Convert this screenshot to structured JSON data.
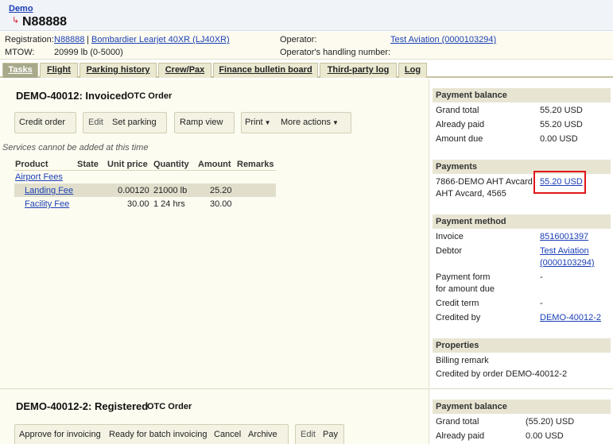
{
  "breadcrumb": {
    "link": "Demo",
    "title": "N88888"
  },
  "aircraft": {
    "registration_label": "Registration:",
    "registration": "N88888",
    "separator": "|",
    "type": "Bombardier Learjet 40XR (LJ40XR)",
    "mtow_label": "MTOW:",
    "mtow": "20999 lb (0-5000)",
    "operator_label": "Operator:",
    "operator": "Test Aviation (0000103294)",
    "handling_label": "Operator's handling number:"
  },
  "tabs": [
    "Tasks",
    "Flight",
    "Parking history",
    "Crew/Pax",
    "Finance bulletin board",
    "Third-party log",
    "Log"
  ],
  "order1": {
    "id": "DEMO-40012: Invoiced",
    "type": "OTC Order",
    "buttons": {
      "credit": "Credit order",
      "edit": "Edit",
      "set_parking": "Set parking",
      "ramp": "Ramp view",
      "print": "Print",
      "more": "More actions"
    },
    "notice": "Services cannot be added at this time",
    "columns": [
      "Product",
      "State",
      "Unit price",
      "Quantity",
      "Amount",
      "Remarks"
    ],
    "group": "Airport Fees",
    "rows": [
      {
        "product": "Landing Fee",
        "state": "",
        "unit_price": "0.00120",
        "quantity": "21000 lb",
        "amount": "25.20",
        "remarks": ""
      },
      {
        "product": "Facility Fee",
        "state": "",
        "unit_price": "30.00",
        "quantity": "1 24 hrs",
        "amount": "30.00",
        "remarks": ""
      }
    ]
  },
  "payment_balance": {
    "header": "Payment balance",
    "grand_total_label": "Grand total",
    "grand_total": "55.20 USD",
    "paid_label": "Already paid",
    "paid": "55.20 USD",
    "due_label": "Amount due",
    "due": "0.00 USD"
  },
  "payments": {
    "header": "Payments",
    "line1": "7866-DEMO AHT Avcard",
    "line2": "AHT Avcard, 4565",
    "amount": "55.20 USD"
  },
  "payment_method": {
    "header": "Payment method",
    "invoice_label": "Invoice",
    "invoice": "8516001397",
    "debtor_label": "Debtor",
    "debtor_1": "Test Aviation",
    "debtor_2": "(0000103294)",
    "form_label_1": "Payment form",
    "form_label_2": "for amount due",
    "form": "-",
    "credit_term_label": "Credit term",
    "credit_term": "-",
    "credited_by_label": "Credited by",
    "credited_by": "DEMO-40012-2"
  },
  "properties": {
    "header": "Properties",
    "billing_remark": "Billing remark",
    "credited_by_order": "Credited by order DEMO-40012-2"
  },
  "order2": {
    "id": "DEMO-40012-2: Registered",
    "type": "OTC Order",
    "buttons": {
      "approve": "Approve for invoicing",
      "ready": "Ready for batch invoicing",
      "cancel": "Cancel",
      "archive": "Archive",
      "edit": "Edit",
      "pay": "Pay"
    }
  },
  "payment_balance2": {
    "header": "Payment balance",
    "grand_total_label": "Grand total",
    "grand_total": "(55.20) USD",
    "paid_label": "Already paid",
    "paid": "0.00 USD"
  },
  "icons": {
    "back": "return-arrow-icon",
    "dropdown": "caret-down-icon"
  },
  "colors": {
    "link": "#1a3fb5",
    "tab_active": "#a9a98b",
    "highlight": "#e0161b"
  }
}
